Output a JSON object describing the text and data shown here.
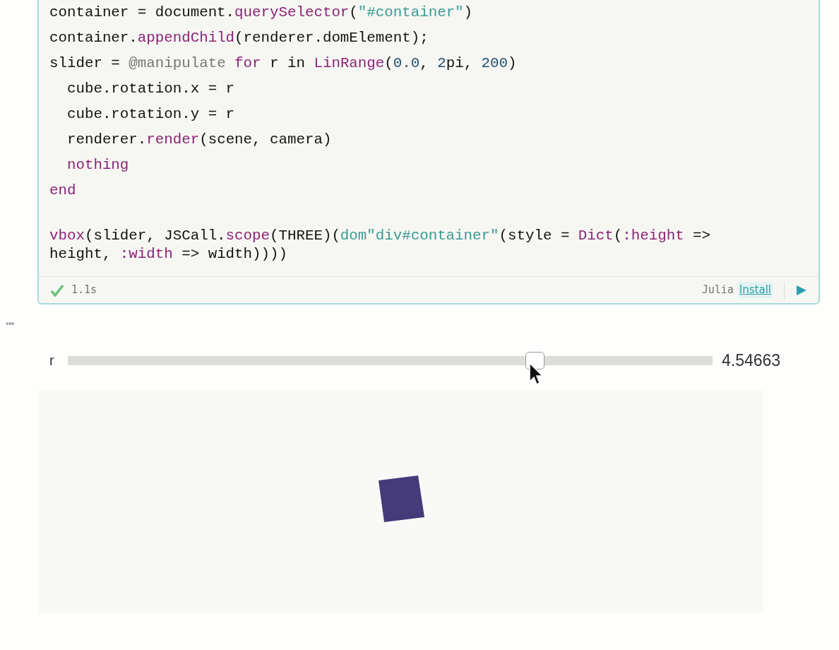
{
  "cell": {
    "code_blocks": [
      [
        [
          {
            "t": "container = document.",
            "kind": "plain"
          },
          {
            "t": "querySelector",
            "kind": "call"
          },
          {
            "t": "(",
            "kind": "plain"
          },
          {
            "t": "\"#container\"",
            "kind": "str"
          },
          {
            "t": ")",
            "kind": "plain"
          }
        ],
        [
          {
            "t": "container.",
            "kind": "plain"
          },
          {
            "t": "appendChild",
            "kind": "call"
          },
          {
            "t": "(renderer.domElement);",
            "kind": "plain"
          }
        ],
        [
          {
            "t": "slider = ",
            "kind": "plain"
          },
          {
            "t": "@manipulate ",
            "kind": "macro"
          },
          {
            "t": "for",
            "kind": "kw"
          },
          {
            "t": " r in ",
            "kind": "plain"
          },
          {
            "t": "LinRange",
            "kind": "call"
          },
          {
            "t": "(",
            "kind": "plain"
          },
          {
            "t": "0.0",
            "kind": "num"
          },
          {
            "t": ", ",
            "kind": "plain"
          },
          {
            "t": "2",
            "kind": "num"
          },
          {
            "t": "pi, ",
            "kind": "plain"
          },
          {
            "t": "200",
            "kind": "num"
          },
          {
            "t": ")",
            "kind": "plain"
          }
        ],
        [
          {
            "t": "  cube.rotation.x = r",
            "kind": "plain"
          }
        ],
        [
          {
            "t": "  cube.rotation.y = r",
            "kind": "plain"
          }
        ],
        [
          {
            "t": "  renderer.",
            "kind": "plain"
          },
          {
            "t": "render",
            "kind": "call"
          },
          {
            "t": "(scene, camera)",
            "kind": "plain"
          }
        ],
        [
          {
            "t": "  nothing",
            "kind": "kw"
          }
        ],
        [
          {
            "t": "end",
            "kind": "kw"
          }
        ]
      ],
      [
        [
          {
            "t": "vbox",
            "kind": "call"
          },
          {
            "t": "(slider, JSCall.",
            "kind": "plain"
          },
          {
            "t": "scope",
            "kind": "call"
          },
          {
            "t": "(THREE)(",
            "kind": "plain"
          },
          {
            "t": "dom\"div#container\"",
            "kind": "str"
          },
          {
            "t": "(style = ",
            "kind": "plain"
          },
          {
            "t": "Dict",
            "kind": "call"
          },
          {
            "t": "(",
            "kind": "plain"
          },
          {
            "t": ":height",
            "kind": "kw"
          },
          {
            "t": " => height, ",
            "kind": "plain"
          },
          {
            "t": ":width",
            "kind": "kw"
          },
          {
            "t": " => width))))",
            "kind": "plain"
          }
        ]
      ]
    ],
    "status": {
      "ok": true,
      "time": "1.1s",
      "language": "Julia",
      "install": "Install"
    }
  },
  "cell_menu": "•••",
  "slider": {
    "label": "r",
    "level": 0.7236,
    "reading": "4.54663"
  }
}
